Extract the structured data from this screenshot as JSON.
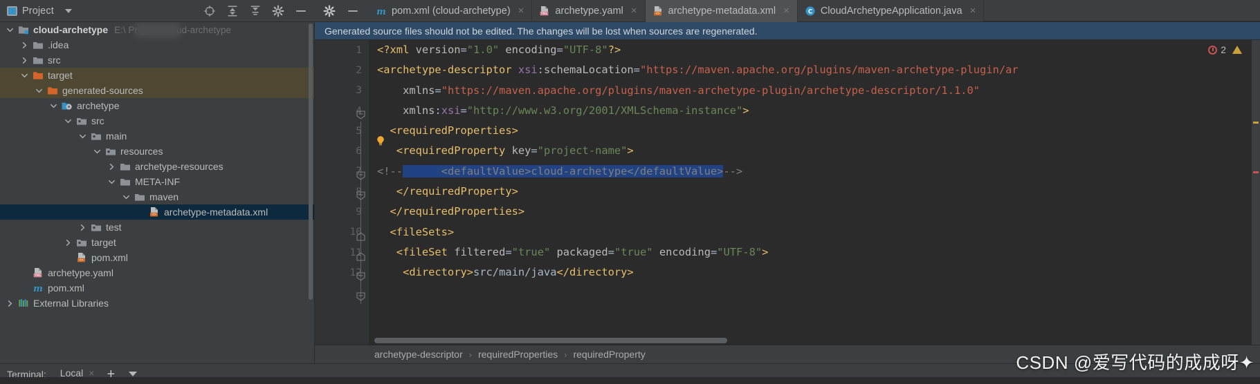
{
  "project_panel": {
    "title": "Project",
    "icons": [
      "target-icon",
      "collapse-all-icon",
      "expand-all-icon",
      "settings-gear-icon",
      "hide-icon"
    ],
    "tree": [
      {
        "label": "cloud-archetype",
        "path": "E:\\           Projects\\cloud-archetype",
        "icon": "module-folder-icon",
        "depth": 0,
        "arrow": "expanded",
        "bold": true,
        "state": "normal"
      },
      {
        "label": ".idea",
        "path": "",
        "icon": "folder-icon",
        "depth": 1,
        "arrow": "collapsed",
        "bold": false,
        "state": "normal"
      },
      {
        "label": "src",
        "path": "",
        "icon": "folder-icon",
        "depth": 1,
        "arrow": "collapsed",
        "bold": false,
        "state": "normal"
      },
      {
        "label": "target",
        "path": "",
        "icon": "folder-orange-icon",
        "depth": 1,
        "arrow": "expanded",
        "bold": false,
        "state": "highlight"
      },
      {
        "label": "generated-sources",
        "path": "",
        "icon": "folder-orange-icon",
        "depth": 2,
        "arrow": "expanded",
        "bold": false,
        "state": "highlight"
      },
      {
        "label": "archetype",
        "path": "",
        "icon": "module-source-icon",
        "depth": 3,
        "arrow": "expanded",
        "bold": false,
        "state": "normal"
      },
      {
        "label": "src",
        "path": "",
        "icon": "folder-source-icon",
        "depth": 4,
        "arrow": "expanded",
        "bold": false,
        "state": "normal"
      },
      {
        "label": "main",
        "path": "",
        "icon": "folder-source-icon",
        "depth": 5,
        "arrow": "expanded",
        "bold": false,
        "state": "normal"
      },
      {
        "label": "resources",
        "path": "",
        "icon": "folder-source-icon",
        "depth": 6,
        "arrow": "expanded",
        "bold": false,
        "state": "normal"
      },
      {
        "label": "archetype-resources",
        "path": "",
        "icon": "folder-icon",
        "depth": 7,
        "arrow": "collapsed",
        "bold": false,
        "state": "normal"
      },
      {
        "label": "META-INF",
        "path": "",
        "icon": "folder-icon",
        "depth": 7,
        "arrow": "expanded",
        "bold": false,
        "state": "normal"
      },
      {
        "label": "maven",
        "path": "",
        "icon": "folder-icon",
        "depth": 8,
        "arrow": "expanded",
        "bold": false,
        "state": "normal"
      },
      {
        "label": "archetype-metadata.xml",
        "path": "",
        "icon": "xml-file-icon",
        "depth": 9,
        "arrow": "none",
        "bold": false,
        "state": "selected"
      },
      {
        "label": "test",
        "path": "",
        "icon": "folder-source-icon",
        "depth": 5,
        "arrow": "collapsed",
        "bold": false,
        "state": "normal"
      },
      {
        "label": "target",
        "path": "",
        "icon": "folder-source-icon",
        "depth": 4,
        "arrow": "collapsed",
        "bold": false,
        "state": "normal"
      },
      {
        "label": "pom.xml",
        "path": "",
        "icon": "xml-file-icon",
        "depth": 4,
        "arrow": "none",
        "bold": false,
        "state": "normal"
      },
      {
        "label": "archetype.yaml",
        "path": "",
        "icon": "yaml-file-icon",
        "depth": 1,
        "arrow": "none",
        "bold": false,
        "state": "normal"
      },
      {
        "label": "pom.xml",
        "path": "",
        "icon": "maven-file-icon",
        "depth": 1,
        "arrow": "none",
        "bold": false,
        "state": "normal"
      },
      {
        "label": "External Libraries",
        "path": "",
        "icon": "libraries-icon",
        "depth": 0,
        "arrow": "collapsed",
        "bold": false,
        "state": "normal"
      }
    ]
  },
  "editor_tabs": {
    "left_icons": [
      "settings-gear-icon",
      "minimize-icon"
    ],
    "tabs": [
      {
        "label": "pom.xml (cloud-archetype)",
        "icon": "maven-file-icon",
        "active": false,
        "close": "×"
      },
      {
        "label": "archetype.yaml",
        "icon": "yaml-file-icon",
        "active": false,
        "close": "×"
      },
      {
        "label": "archetype-metadata.xml",
        "icon": "xml-file-icon",
        "active": true,
        "close": "×"
      },
      {
        "label": "CloudArchetypeApplication.java",
        "icon": "java-class-icon",
        "active": false,
        "close": "×"
      }
    ]
  },
  "notification": {
    "text": "Generated source files should not be edited. The changes will be lost when sources are regenerated."
  },
  "editor": {
    "error_count": "2",
    "line_numbers": [
      "1",
      "2",
      "3",
      "4",
      "5",
      "6",
      "7",
      "8",
      "9",
      "10",
      "11",
      "12"
    ],
    "lines": [
      {
        "n": "1",
        "segments": [
          {
            "t": "<?xml ",
            "c": "tag"
          },
          {
            "t": "version",
            "c": "attr2"
          },
          {
            "t": "=",
            "c": "txt"
          },
          {
            "t": "\"1.0\"",
            "c": "str"
          },
          {
            "t": " ",
            "c": "txt"
          },
          {
            "t": "encoding",
            "c": "attr2"
          },
          {
            "t": "=",
            "c": "txt"
          },
          {
            "t": "\"UTF-8\"",
            "c": "str"
          },
          {
            "t": "?>",
            "c": "tag"
          }
        ]
      },
      {
        "n": "2",
        "segments": [
          {
            "t": "<archetype-descriptor ",
            "c": "tag"
          },
          {
            "t": "xsi",
            "c": "attr"
          },
          {
            "t": ":schemaLocation",
            "c": "attr2"
          },
          {
            "t": "=",
            "c": "txt"
          },
          {
            "t": "\"https://maven.apache.org/plugins/maven-archetype-plugin/ar",
            "c": "urlred"
          }
        ]
      },
      {
        "n": "3",
        "segments": [
          {
            "t": "    xmlns",
            "c": "attr2"
          },
          {
            "t": "=",
            "c": "txt"
          },
          {
            "t": "\"https://maven.apache.org/plugins/maven-archetype-plugin/archetype-descriptor/1.1.0\"",
            "c": "urlred"
          }
        ]
      },
      {
        "n": "4",
        "segments": [
          {
            "t": "    xmlns",
            "c": "attr2"
          },
          {
            "t": ":",
            "c": "txt"
          },
          {
            "t": "xsi",
            "c": "attr"
          },
          {
            "t": "=",
            "c": "txt"
          },
          {
            "t": "\"http://www.w3.org/2001/XMLSchema-instance\"",
            "c": "str"
          },
          {
            "t": ">",
            "c": "tag"
          }
        ]
      },
      {
        "n": "5",
        "segments": [
          {
            "t": "  <requiredProperties>",
            "c": "tag"
          }
        ]
      },
      {
        "n": "6",
        "segments": [
          {
            "t": "   <requiredProperty ",
            "c": "tag"
          },
          {
            "t": "key",
            "c": "attr2"
          },
          {
            "t": "=",
            "c": "txt"
          },
          {
            "t": "\"project-name\"",
            "c": "str"
          },
          {
            "t": ">",
            "c": "tag"
          }
        ]
      },
      {
        "n": "7",
        "comment_prefix": "<!--",
        "selected_text": "      <defaultValue>cloud-archetype</defaultValue>",
        "comment_suffix": "-->"
      },
      {
        "n": "8",
        "segments": [
          {
            "t": "   </requiredProperty>",
            "c": "tag"
          }
        ]
      },
      {
        "n": "9",
        "segments": [
          {
            "t": "  </requiredProperties>",
            "c": "tag"
          }
        ]
      },
      {
        "n": "10",
        "segments": [
          {
            "t": "  <fileSets>",
            "c": "tag"
          }
        ]
      },
      {
        "n": "11",
        "segments": [
          {
            "t": "   <fileSet ",
            "c": "tag"
          },
          {
            "t": "filtered",
            "c": "attr2"
          },
          {
            "t": "=",
            "c": "txt"
          },
          {
            "t": "\"true\"",
            "c": "str"
          },
          {
            "t": " ",
            "c": "txt"
          },
          {
            "t": "packaged",
            "c": "attr2"
          },
          {
            "t": "=",
            "c": "txt"
          },
          {
            "t": "\"true\"",
            "c": "str"
          },
          {
            "t": " ",
            "c": "txt"
          },
          {
            "t": "encoding",
            "c": "attr2"
          },
          {
            "t": "=",
            "c": "txt"
          },
          {
            "t": "\"UTF-8\"",
            "c": "str"
          },
          {
            "t": ">",
            "c": "tag"
          }
        ]
      },
      {
        "n": "12",
        "segments": [
          {
            "t": "    <directory>",
            "c": "tag"
          },
          {
            "t": "src/main/java",
            "c": "txt"
          },
          {
            "t": "</directory>",
            "c": "tag"
          }
        ]
      }
    ]
  },
  "breadcrumb": {
    "items": [
      "archetype-descriptor",
      "requiredProperties",
      "requiredProperty"
    ],
    "separator": "›"
  },
  "terminal_bar": {
    "label": "Terminal:",
    "tab_label": "Local",
    "close": "×",
    "add": "+",
    "chevron": "chevron-down-icon"
  },
  "watermark": {
    "text": "CSDN @爱写代码的成成呀✦"
  },
  "colors": {
    "panel_bg": "#3c3f41",
    "editor_bg": "#2b2b2b",
    "selection": "#214283",
    "tree_selected": "#0d293e",
    "tree_highlight": "#4e4833",
    "notification_bg": "#2f4a66",
    "accent_orange": "#cc7832"
  }
}
